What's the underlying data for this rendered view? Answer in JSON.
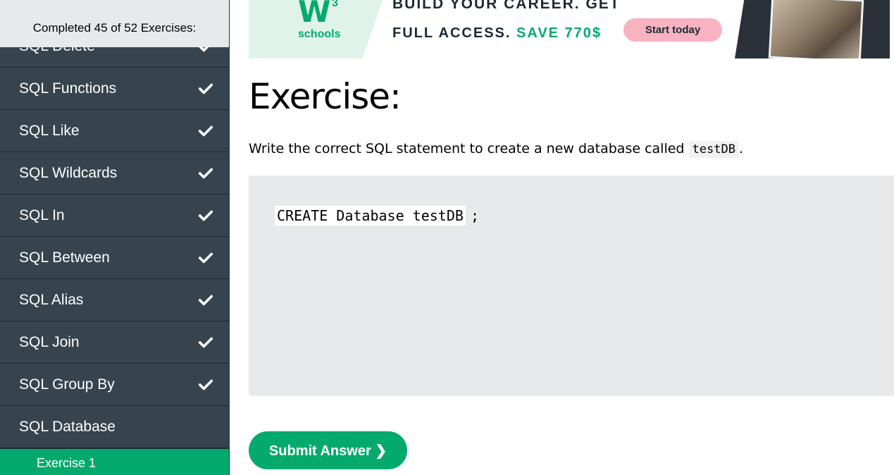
{
  "sidebar": {
    "progress_text": "Completed 45 of 52 Exercises:",
    "items": [
      {
        "label": "SQL Delete",
        "done": true
      },
      {
        "label": "SQL Functions",
        "done": true
      },
      {
        "label": "SQL Like",
        "done": true
      },
      {
        "label": "SQL Wildcards",
        "done": true
      },
      {
        "label": "SQL In",
        "done": true
      },
      {
        "label": "SQL Between",
        "done": true
      },
      {
        "label": "SQL Alias",
        "done": true
      },
      {
        "label": "SQL Join",
        "done": true
      },
      {
        "label": "SQL Group By",
        "done": true
      },
      {
        "label": "SQL Database",
        "done": false
      }
    ],
    "sub_item": "Exercise 1"
  },
  "ad": {
    "logo_mark": "W",
    "logo_sup": "3",
    "logo_text": "schools",
    "line1": "BUILD YOUR CAREER. GET",
    "line2_prefix": "FULL ACCESS.",
    "line2_save": "SAVE 770$",
    "cta": "Start today"
  },
  "exercise": {
    "title": "Exercise:",
    "instruction_prefix": "Write the correct SQL statement to create a new database called",
    "instruction_code": "testDB",
    "instruction_suffix": ".",
    "answer": "CREATE Database testDB",
    "answer_suffix": ";",
    "submit_label": "Submit Answer ❯"
  },
  "colors": {
    "accent": "#04aa6d",
    "sidebar_bg": "#38444d",
    "code_bg": "#e7e9eb",
    "cta_bg": "#f8b2c0"
  },
  "icons": {
    "check": "check-icon"
  }
}
